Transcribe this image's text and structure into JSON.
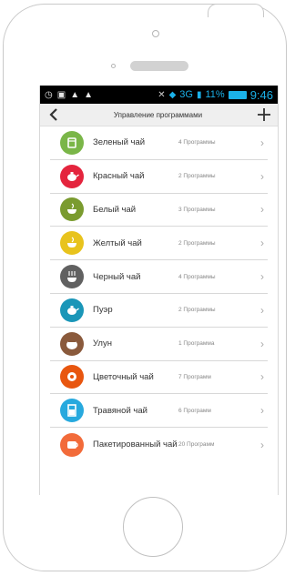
{
  "status_bar": {
    "network": "3G",
    "battery": "11%",
    "time": "9:46"
  },
  "header": {
    "back_icon": "chevron-left-icon",
    "title": "Управление программами",
    "add_icon": "plus-icon"
  },
  "teas": [
    {
      "name": "Зеленый чай",
      "count": "4 Программы",
      "color": "#7ab648",
      "icon": "cup-icon"
    },
    {
      "name": "Красный чай",
      "count": "2 Программы",
      "color": "#e4243d",
      "icon": "teapot-icon"
    },
    {
      "name": "Белый чай",
      "count": "3 Программы",
      "color": "#7a9b2f",
      "icon": "leaf-cup-icon"
    },
    {
      "name": "Желтый чай",
      "count": "2 Программы",
      "color": "#e8c31d",
      "icon": "leaf-cup-icon"
    },
    {
      "name": "Черный чай",
      "count": "4 Программы",
      "color": "#616161",
      "icon": "steam-cup-icon"
    },
    {
      "name": "Пуэр",
      "count": "2 Программы",
      "color": "#1a96b8",
      "icon": "teapot-icon"
    },
    {
      "name": "Улун",
      "count": "1 Программа",
      "color": "#8a5a3c",
      "icon": "pot-icon"
    },
    {
      "name": "Цветочный  чай",
      "count": "7 Программ",
      "color": "#e8560f",
      "icon": "flower-cup-icon"
    },
    {
      "name": "Травяной чай",
      "count": "6 Программ",
      "color": "#27a9de",
      "icon": "glass-icon"
    },
    {
      "name": "Пакетированный чай",
      "count": "20 Программ",
      "color": "#f26b3a",
      "icon": "teabag-icon"
    }
  ]
}
